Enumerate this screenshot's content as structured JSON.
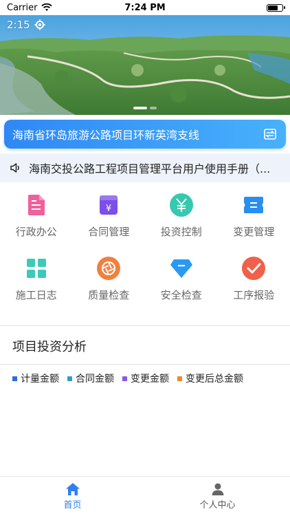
{
  "status_bar": {
    "carrier": "Carrier",
    "time": "7:24 PM"
  },
  "banner": {
    "clock": "2:15",
    "settings_icon": "gear-icon",
    "active_dot": 0,
    "dot_count": 2
  },
  "project": {
    "name": "海南省环岛旅游公路项目环新英湾支线",
    "switch_icon": "swap-icon"
  },
  "notice": {
    "icon": "speaker-icon",
    "text": "海南交投公路工程项目管理平台用户使用手册（..."
  },
  "menu": [
    {
      "label": "行政办公",
      "icon": "document-icon",
      "color": "#f0609b"
    },
    {
      "label": "合同管理",
      "icon": "contract-icon",
      "color": "#7b4fe8"
    },
    {
      "label": "投资控制",
      "icon": "yen-icon",
      "color": "#35c9b0"
    },
    {
      "label": "变更管理",
      "icon": "ticket-icon",
      "color": "#2a8ef0"
    },
    {
      "label": "施工日志",
      "icon": "grid-icon",
      "color": "#3cc9b8"
    },
    {
      "label": "质量检查",
      "icon": "aperture-icon",
      "color": "#f08040"
    },
    {
      "label": "安全检查",
      "icon": "shield-diamond-icon",
      "color": "#2a9af0"
    },
    {
      "label": "工序报验",
      "icon": "check-icon",
      "color": "#f0604a"
    }
  ],
  "analysis": {
    "title": "项目投资分析",
    "legend": [
      {
        "label": "计量金额",
        "color": "#2f6bd8"
      },
      {
        "label": "合同金额",
        "color": "#2aa0c8"
      },
      {
        "label": "变更金额",
        "color": "#8a5be0"
      },
      {
        "label": "变更后总金额",
        "color": "#f08a24"
      }
    ]
  },
  "tabbar": [
    {
      "label": "首页",
      "icon": "home-icon",
      "active": true
    },
    {
      "label": "个人中心",
      "icon": "person-icon",
      "active": false
    }
  ]
}
